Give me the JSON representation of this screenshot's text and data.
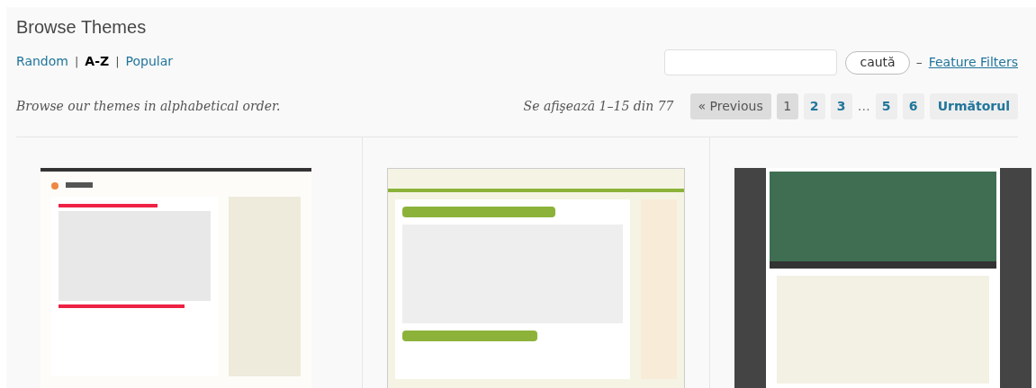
{
  "title": "Browse Themes",
  "view_links": [
    {
      "label": "Random",
      "selected": false
    },
    {
      "label": "A-Z",
      "selected": true
    },
    {
      "label": "Popular",
      "selected": false
    }
  ],
  "view_separator": "|",
  "search": {
    "button": "caută",
    "dash": "–",
    "link": "Feature Filters"
  },
  "description": "Browse our themes in alphabetical order.",
  "pagination": {
    "summary": "Se afişează 1–15 din 77",
    "items": [
      {
        "kind": "nav",
        "label": "« Previous",
        "disabled": true
      },
      {
        "kind": "page",
        "label": "1",
        "selected": true
      },
      {
        "kind": "page",
        "label": "2",
        "selected": false
      },
      {
        "kind": "page",
        "label": "3",
        "selected": false
      },
      {
        "kind": "ellipsis",
        "label": "…"
      },
      {
        "kind": "page",
        "label": "5",
        "selected": false
      },
      {
        "kind": "page",
        "label": "6",
        "selected": false
      },
      {
        "kind": "nav",
        "label": "Următorul",
        "disabled": false
      }
    ]
  },
  "themes": [
    {
      "kind": "light"
    },
    {
      "kind": "green"
    },
    {
      "kind": "dark"
    }
  ]
}
